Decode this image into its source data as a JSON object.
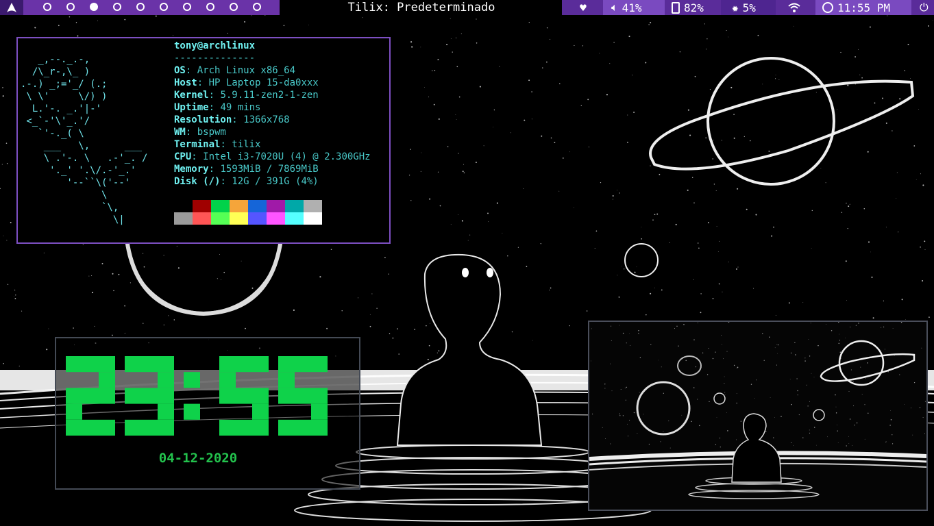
{
  "topbar": {
    "workspaces": [
      "1",
      "2",
      "3",
      "4",
      "5",
      "6",
      "7",
      "8",
      "9",
      "10"
    ],
    "active_workspace": 3,
    "window_title": "Tilix: Predeterminado",
    "volume": "41%",
    "battery": "82%",
    "brightness": "5%",
    "time": "11:55 PM"
  },
  "neofetch": {
    "header": "tony@archlinux",
    "separator": "--------------",
    "ascii": "   _,--._.-,\n  /\\_r-,\\_ )\n.-.) _;='_/ (.;\n \\ \\'     \\/) )\n  L.'-. _.'|-'\n <_`-'\\'_.'/\n   `'-._( \\\n    ___   \\,      ___\n    \\ .'-. \\   .-'_. /\n     '._' '.\\/.-'_.'\n        '--``\\('--'\n              \\\n              `\\,\n                \\|",
    "rows": [
      {
        "key": "OS",
        "value": "Arch Linux x86_64"
      },
      {
        "key": "Host",
        "value": "HP Laptop 15-da0xxx"
      },
      {
        "key": "Kernel",
        "value": "5.9.11-zen2-1-zen"
      },
      {
        "key": "Uptime",
        "value": "49 mins"
      },
      {
        "key": "Resolution",
        "value": "1366x768"
      },
      {
        "key": "WM",
        "value": "bspwm"
      },
      {
        "key": "Terminal",
        "value": "tilix"
      },
      {
        "key": "CPU",
        "value": "Intel i3-7020U (4) @ 2.300GHz"
      },
      {
        "key": "Memory",
        "value": "1593MiB / 7869MiB"
      },
      {
        "key": "Disk (/)",
        "value": "12G / 391G (4%)"
      }
    ],
    "palette_row1": [
      "#000000",
      "#a00000",
      "#00d24a",
      "#f5a53a",
      "#1565d8",
      "#a01aa8",
      "#00a8a8",
      "#b0b0b0"
    ],
    "palette_row2": [
      "#9a9a9a",
      "#ff5555",
      "#55ff55",
      "#ffff55",
      "#5555ff",
      "#ff55ff",
      "#55ffff",
      "#ffffff"
    ]
  },
  "clock": {
    "time": "23:55",
    "date": "04-12-2020",
    "color": "#0fd24a"
  },
  "colors": {
    "bar_purple": "#6a33a8",
    "border_purple": "#7d4fc2",
    "cyan": "#49c9c9"
  }
}
